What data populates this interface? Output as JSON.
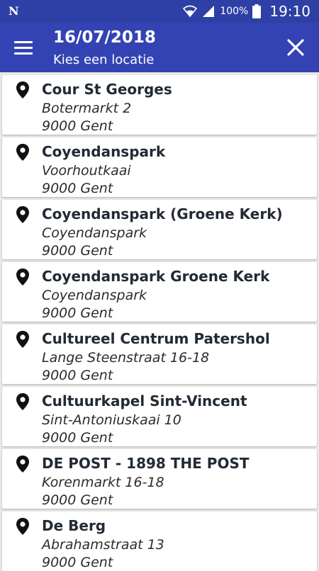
{
  "statusbar": {
    "notification_icon": "N",
    "battery_percent": "100%",
    "time": "19:10",
    "icons": [
      "wifi-icon",
      "signal-icon",
      "battery-icon"
    ]
  },
  "appbar": {
    "title": "16/07/2018",
    "subtitle": "Kies een locatie",
    "menu_icon": "hamburger-menu-icon",
    "close_icon": "close-icon"
  },
  "colors": {
    "statusbar": "#2e40a5",
    "appbar": "#3443b3",
    "background": "#e9e9e9",
    "card": "#ffffff",
    "text": "#222a35"
  },
  "locations": [
    {
      "name": "Cour St Georges",
      "street": "Botermarkt 2",
      "city": "9000 Gent"
    },
    {
      "name": "Coyendanspark",
      "street": "Voorhoutkaai",
      "city": "9000 Gent"
    },
    {
      "name": "Coyendanspark (Groene Kerk)",
      "street": "Coyendanspark",
      "city": "9000 Gent"
    },
    {
      "name": "Coyendanspark Groene Kerk",
      "street": "Coyendanspark",
      "city": "9000 Gent"
    },
    {
      "name": "Cultureel Centrum Patershol",
      "street": "Lange Steenstraat 16-18",
      "city": "9000 Gent"
    },
    {
      "name": "Cultuurkapel Sint-Vincent",
      "street": "Sint-Antoniuskaai 10",
      "city": "9000 Gent"
    },
    {
      "name": "DE POST - 1898 THE POST",
      "street": "Korenmarkt 16-18",
      "city": "9000 Gent"
    },
    {
      "name": "De Berg",
      "street": "Abrahamstraat 13",
      "city": "9000 Gent"
    }
  ]
}
